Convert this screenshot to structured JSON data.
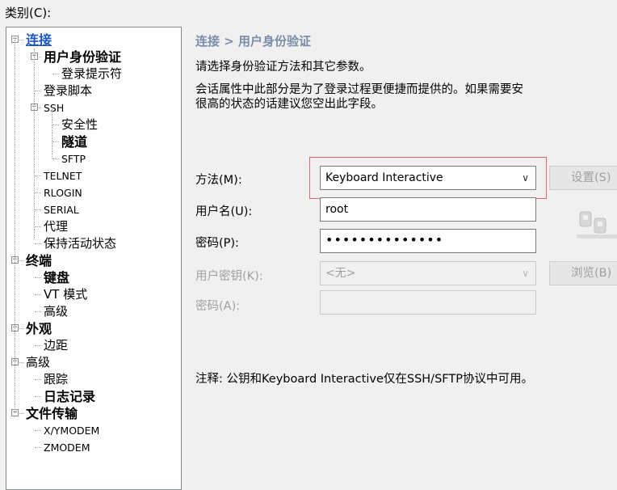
{
  "category_label": "类别(C):",
  "tree": [
    {
      "id": "conn",
      "label": "连接",
      "level": 0,
      "style": "link",
      "expander": "minus"
    },
    {
      "id": "auth",
      "label": "用户身份验证",
      "level": 1,
      "style": "sel",
      "expander": "minus"
    },
    {
      "id": "login-prompt",
      "label": "登录提示符",
      "level": 2,
      "style": "normal"
    },
    {
      "id": "login-script",
      "label": "登录脚本",
      "level": 1,
      "style": "normal"
    },
    {
      "id": "ssh",
      "label": "SSH",
      "level": 1,
      "style": "small",
      "expander": "minus"
    },
    {
      "id": "security",
      "label": "安全性",
      "level": 2,
      "style": "normal"
    },
    {
      "id": "tunnel",
      "label": "隧道",
      "level": 2,
      "style": "bold"
    },
    {
      "id": "sftp",
      "label": "SFTP",
      "level": 2,
      "style": "small"
    },
    {
      "id": "telnet",
      "label": "TELNET",
      "level": 1,
      "style": "small"
    },
    {
      "id": "rlogin",
      "label": "RLOGIN",
      "level": 1,
      "style": "small"
    },
    {
      "id": "serial",
      "label": "SERIAL",
      "level": 1,
      "style": "small"
    },
    {
      "id": "proxy",
      "label": "代理",
      "level": 1,
      "style": "normal"
    },
    {
      "id": "keepalive",
      "label": "保持活动状态",
      "level": 1,
      "style": "normal"
    },
    {
      "id": "terminal",
      "label": "终端",
      "level": 0,
      "style": "bold",
      "expander": "minus"
    },
    {
      "id": "keyboard",
      "label": "键盘",
      "level": 1,
      "style": "bold"
    },
    {
      "id": "vt-mode",
      "label": "VT 模式",
      "level": 1,
      "style": "normal"
    },
    {
      "id": "term-advanced",
      "label": "高级",
      "level": 1,
      "style": "normal"
    },
    {
      "id": "appearance",
      "label": "外观",
      "level": 0,
      "style": "bold",
      "expander": "minus"
    },
    {
      "id": "margin",
      "label": "边距",
      "level": 1,
      "style": "normal"
    },
    {
      "id": "advanced",
      "label": "高级",
      "level": 0,
      "style": "normal",
      "expander": "minus"
    },
    {
      "id": "trace",
      "label": "跟踪",
      "level": 1,
      "style": "normal"
    },
    {
      "id": "logging",
      "label": "日志记录",
      "level": 1,
      "style": "bold"
    },
    {
      "id": "file-transfer",
      "label": "文件传输",
      "level": 0,
      "style": "bold",
      "expander": "minus"
    },
    {
      "id": "xymodem",
      "label": "X/YMODEM",
      "level": 1,
      "style": "small"
    },
    {
      "id": "zmodem",
      "label": "ZMODEM",
      "level": 1,
      "style": "small"
    }
  ],
  "breadcrumb": "连接 > 用户身份验证",
  "desc_line1": "请选择身份验证方法和其它参数。",
  "desc_line2": "会话属性中此部分是为了登录过程更便捷而提供的。如果需要安",
  "desc_line3": "很高的状态的话建议您空出此字段。",
  "method": {
    "label": "方法(M):",
    "value": "Keyboard Interactive",
    "button": "设置(S)"
  },
  "username": {
    "label": "用户名(U):",
    "value": "root"
  },
  "password": {
    "label": "密码(P):",
    "value": "••••••••••••••"
  },
  "user_key": {
    "label": "用户密钥(K):",
    "value": "<无>",
    "button": "浏览(B)"
  },
  "passphrase": {
    "label": "密码(A):",
    "value": ""
  },
  "note": "注释: 公钥和Keyboard Interactive仅在SSH/SFTP协议中可用。"
}
